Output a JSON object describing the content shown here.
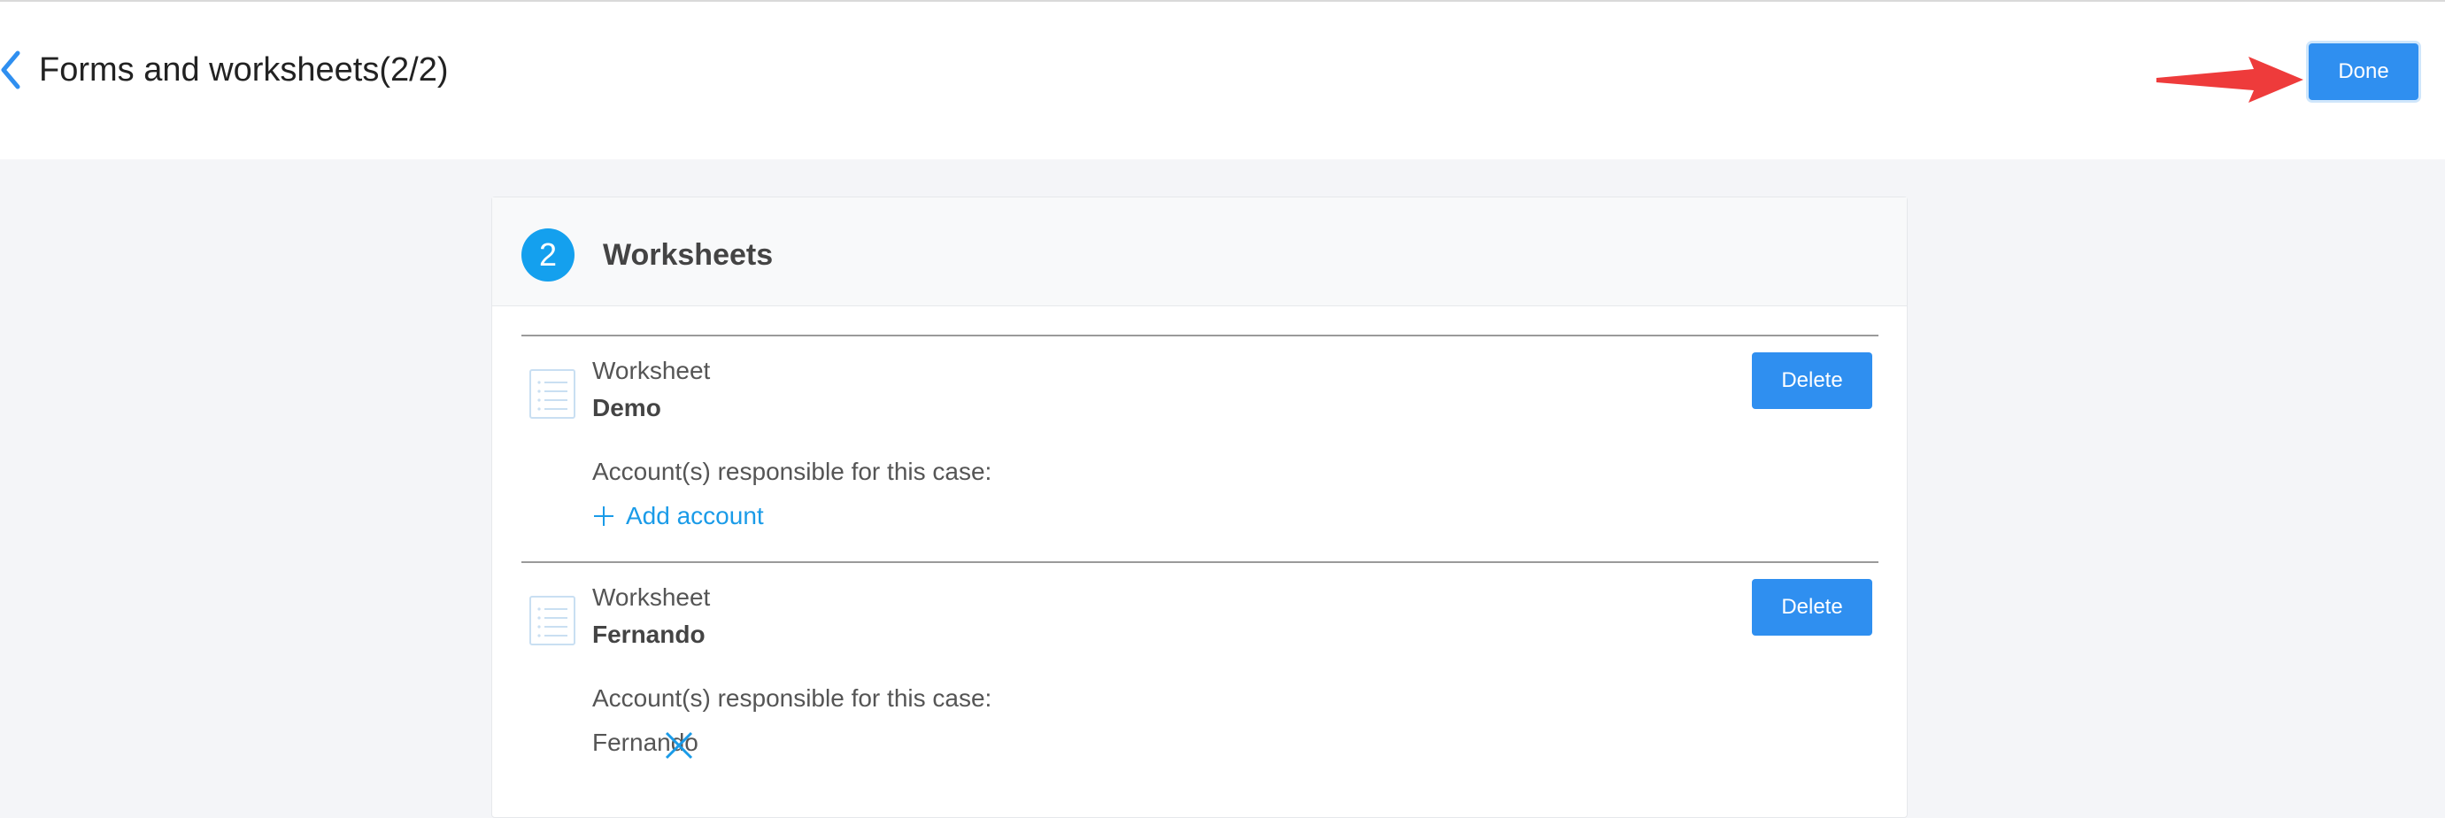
{
  "header": {
    "title": "Forms and worksheets(2/2)",
    "done_label": "Done"
  },
  "icons": {
    "back": "chevron-left-icon",
    "annotation": "red-arrow-pointer",
    "worksheet": "list-document-icon",
    "add": "plus-icon",
    "remove": "close-icon"
  },
  "colors": {
    "primary": "#2f8ff0",
    "badge": "#14a0ee",
    "link": "#1a9be8",
    "annotation_arrow": "#ee3b3b"
  },
  "section": {
    "step": "2",
    "title": "Worksheets"
  },
  "worksheets": [
    {
      "type_label": "Worksheet",
      "name": "Demo",
      "delete_label": "Delete",
      "responsible_label": "Account(s) responsible for this case:",
      "add_account_label": "Add account"
    },
    {
      "type_label": "Worksheet",
      "name": "Fernando",
      "delete_label": "Delete",
      "responsible_label": "Account(s) responsible for this case:",
      "account": "Fernando"
    }
  ]
}
